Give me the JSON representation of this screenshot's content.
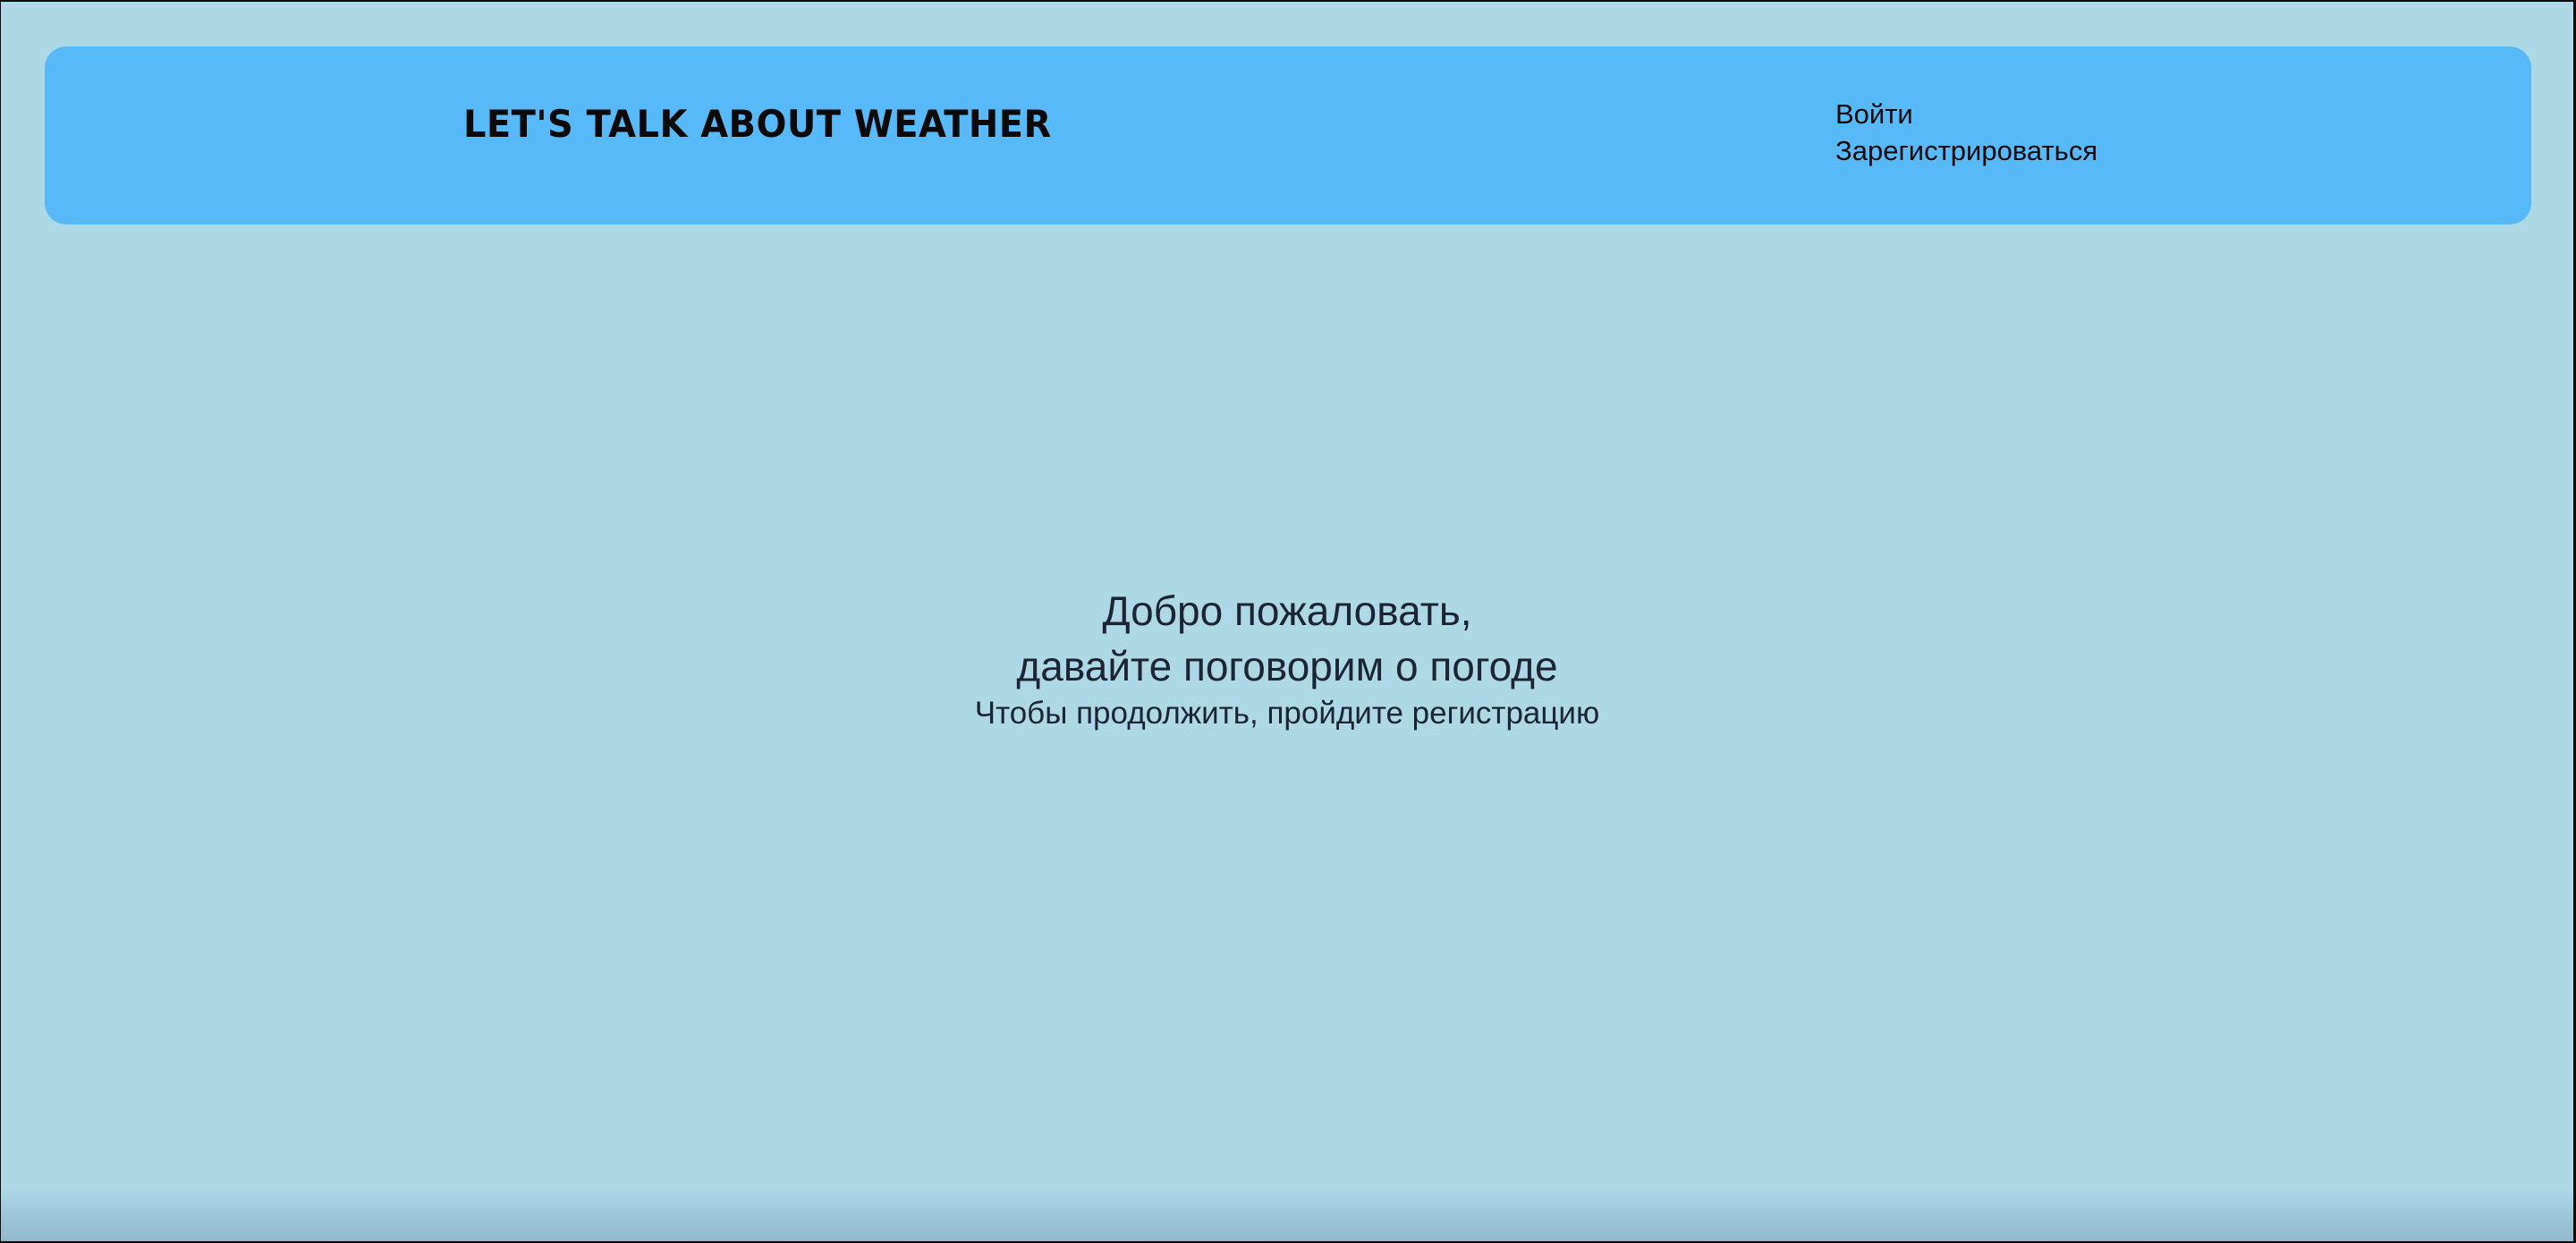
{
  "header": {
    "logo_text": "Let's talk about weather",
    "nav": {
      "login_label": "Войти",
      "register_label": "Зарегистрироваться"
    }
  },
  "hero": {
    "title_line1": "Добро пожаловать,",
    "title_line2": "давайте поговорим о погоде",
    "subtitle": "Чтобы продолжить, пройдите регистрацию"
  },
  "colors": {
    "page_background": "#add8e6",
    "header_background": "#57b9f7",
    "text_primary": "#0a0a0a",
    "text_hero": "#1c2535"
  }
}
